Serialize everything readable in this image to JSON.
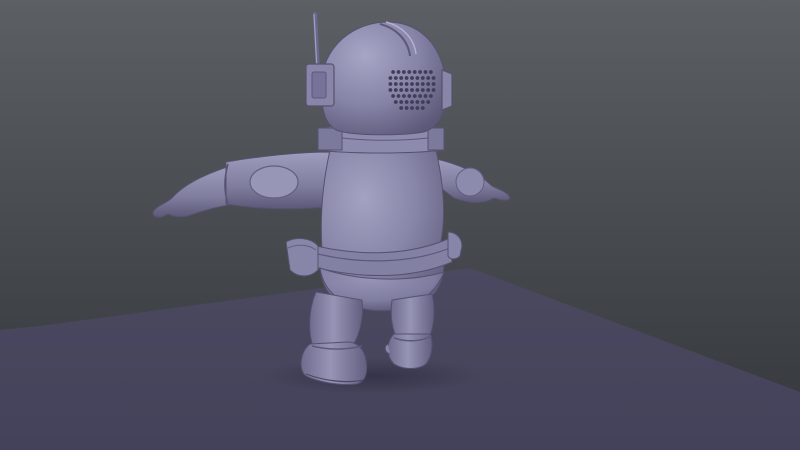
{
  "scene": {
    "subject": "robot-character-model",
    "view": "back-three-quarter",
    "pose": "t-pose",
    "shading": "flat-clay",
    "colors": {
      "background_top": "#5c6064",
      "background_bottom": "#33363b",
      "floor": "#44425a",
      "floor_far": "#4b4960",
      "model_base": "#8583a6",
      "model_light": "#a6a4c4",
      "model_shadow": "#5b5878",
      "model_dark": "#403d58"
    }
  }
}
